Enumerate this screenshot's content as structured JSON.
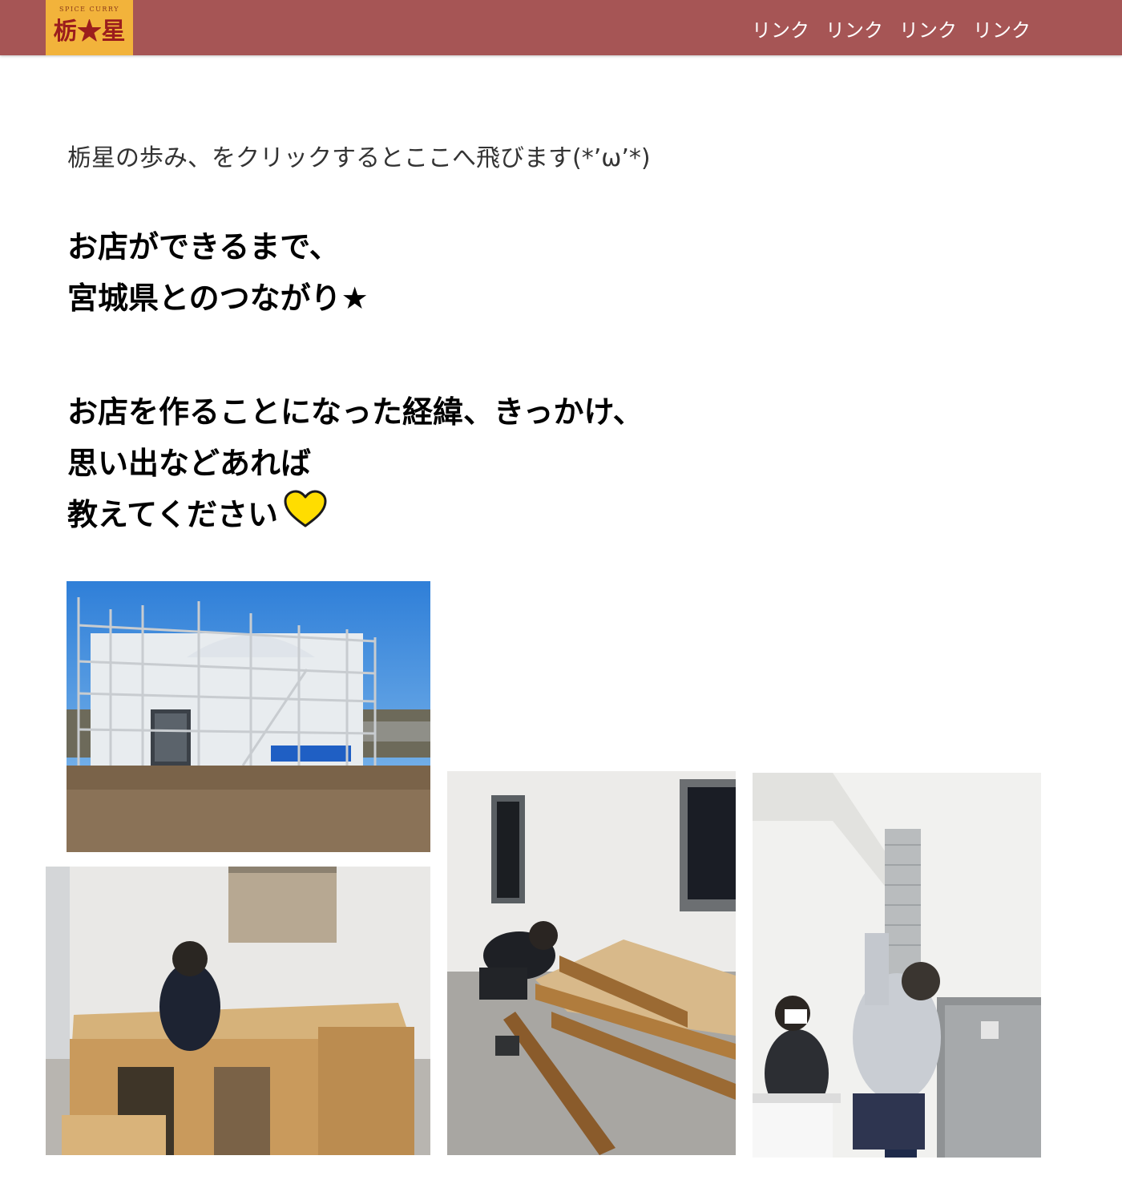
{
  "header": {
    "logo_sub": "SPICE CURRY",
    "logo_main": "栃★星",
    "nav": [
      "リンク",
      "リンク",
      "リンク",
      "リンク"
    ],
    "colors": {
      "bar": "#a65555",
      "logo_bg": "#f2b33b"
    }
  },
  "intro": "栃星の歩み、をクリックするとここへ飛びます(*’ω’*)",
  "heading1": {
    "line1": "お店ができるまで、",
    "line2": "宮城県とのつながり★"
  },
  "heading2": {
    "line1": "お店を作ることになった経緯、きっかけ、",
    "line2": "思い出などあれば",
    "line3": "教えてください",
    "icon": "yellow-heart-icon"
  },
  "photos": [
    {
      "name": "construction-scaffolding-photo"
    },
    {
      "name": "raised-floor-platform-photo"
    },
    {
      "name": "floor-frame-assembly-photo"
    },
    {
      "name": "duct-installation-photo"
    }
  ]
}
